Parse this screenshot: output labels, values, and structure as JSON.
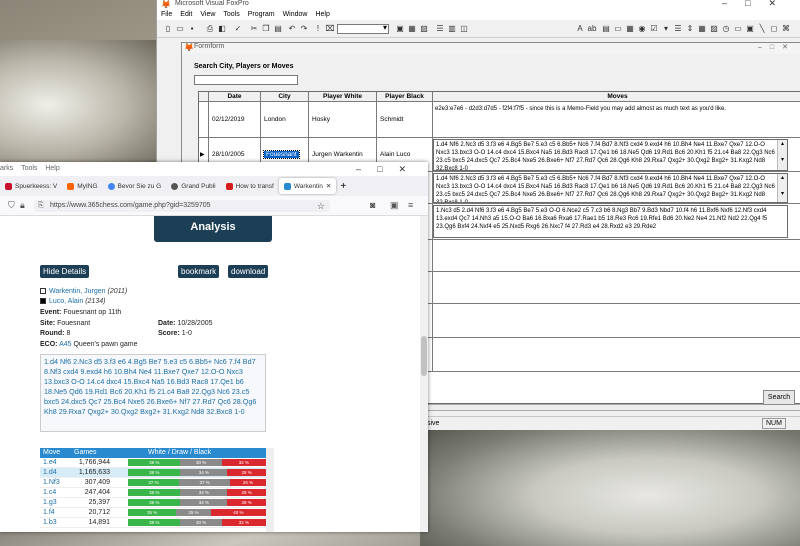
{
  "vfp": {
    "title": "Microsoft Visual FoxPro",
    "menu": [
      "File",
      "Edit",
      "View",
      "Tools",
      "Program",
      "Window",
      "Help"
    ],
    "form_title": "Formform",
    "search_label": "Search City, Players or Moves",
    "search_value": "",
    "columns": [
      "Date",
      "City",
      "Player White",
      "Player Black",
      "Moves"
    ],
    "rows": [
      {
        "date": "02/12/2019",
        "city": "London",
        "white": "Hosky",
        "black": "Schmidt",
        "moves": "e2e3:e7e6 - d2d3:d7d5 - f2f4:f7f5 - since this is a Memo-Field you may add almost as much text as you'd like."
      },
      {
        "date": "28/10/2005",
        "city": "Fouesnant",
        "white": "Jurgen Warkentin",
        "black": "Alain Luco",
        "moves": "1.d4 Nf6 2.Nc3 d5 3.f3 e6 4.Bg5 Be7 5.e3 c5 6.Bb5+ Nc6 7.f4 Bd7 8.Nf3 cxd4 9.exd4 h6 10.Bh4 Ne4 11.Bxe7 Qxe7 12.O-O Nxc3 13.bxc3 O-O 14.c4 dxc4 15.Bxc4 Na5 16.Bd3 Rac8 17.Qe1 b6 18.Ne5 Qd6 19.Rd1 Bc6 20.Kh1 f5 21.c4 Ba8 22.Qg3 Nc6 23.c5 bxc5 24.dxc5 Qc7 25.Bc4 Nxe5 26.Bxe6+ Nf7 27.Rd7 Qc6 28.Qg6 Kh8 29.Rxa7 Qxg2+ 30.Qxg2 Bxg2+ 31.Kxg2 Nd8 32.Bxc8 1-0"
      },
      {
        "date": "",
        "city": "",
        "white": "",
        "black": "",
        "moves": "1.d4 Nf6 2.Nc3 d5 3.f3 e6 4.Bg5 Be7 5.e3 c5 6.Bb5+ Nc6 7.f4 Bd7 8.Nf3 cxd4 9.exd4 h6 10.Bh4 Ne4 11.Bxe7 Qxe7 12.O-O Nxc3 13.bxc3 O-O 14.c4 dxc4 15.Bxc4 Na5 16.Bd3 Rac8 17.Qe1 b6 18.Ne5 Qd6 19.Rd1 Bc6 20.Kh1 f5 21.c4 Ba8 22.Qg3 Nc6 23.c5 bxc5 24.dxc5 Qc7 25.Bc4 Nxe5 26.Bxe6+ Nf7 27.Rd7 Qc6 28.Qg6 Kh8 29.Rxa7 Qxg2+ 30.Qxg2 Bxg2+ 31.Kxg2 Nd8 32.Bxc8 1-0"
      },
      {
        "date": "",
        "city": "",
        "white": "",
        "black": "",
        "moves": "1.Nc3 d5 2.d4 Nf6 3.f3 e6 4.Bg5 Be7 5.e3 O-O 6.Nce2 c5 7.c3 b6 8.Ng3 Bb7 9.Bd3 Nbd7 10.f4 h6 11.Bxf6 Nxf6 12.Nf3 cxd4 13.exd4 Qc7 14.Nh3 a5 15.O-O Ba6 16.Bxa6 Rxa6 17.Rae1 b5 18.Re3 Rc6 19.Rfe1 Bd6 20.Ne2 Ne4 21.Nf2 Nd2 22.Qg4 f5 23.Qg6 Bxf4 24.Nxf4 e5 25.Nxd5 Rxg6 26.Nxc7 f4 27.Rd3 e4 28.Rxd2 e3 29.Rde2"
      }
    ],
    "search_btn": "Search",
    "status_text": "sive",
    "status_num": "NUM"
  },
  "ff": {
    "menu": [
      "arks",
      "Tools",
      "Help"
    ],
    "tabs": [
      "Spuerkeess: V",
      "MyING",
      "Bevor Sie zu G",
      "Grand Publi",
      "How to transf",
      "Warkentin"
    ],
    "url": "https://www.365chess.com/game.php?gid=3259705",
    "analysis": "Analysis",
    "hide": "Hide Details",
    "bookmark": "bookmark",
    "download": "download",
    "white_name": "Warkentin, Jurgen",
    "white_elo": "(2011)",
    "black_name": "Luco, Alain",
    "black_elo": "(2134)",
    "event_label": "Event:",
    "event": "Fouesnant op 11th",
    "site_label": "Site:",
    "site": "Fouesnant",
    "date_label": "Date:",
    "date": "10/28/2005",
    "round_label": "Round:",
    "round": "8",
    "score_label": "Score:",
    "score": "1-0",
    "eco_label": "ECO:",
    "eco": "A45",
    "eco_name": "Queen's pawn game",
    "moves_text": "1.d4 Nf6 2.Nc3 d5 3.f3 e6 4.Bg5 Be7 5.e3 c5 6.Bb5+ Nc6 7.f4 Bd7 8.Nf3 cxd4 9.exd4 h6 10.Bh4 Ne4 11.Bxe7 Qxe7 12.O-O Nxc3 13.bxc3 O-O 14.c4 dxc4 15.Bxc4 Na5 16.Bd3 Rac8 17.Qe1 b6 18.Ne5 Qd6 19.Rd1 Bc6 20.Kh1 f5 21.c4 Ba8 22.Qg3 Nc6 23.c5 bxc5 24.dxc5 Qc7 25.Bc4 Nxe5 26.Bxe6+ Nf7 27.Rd7 Qc6 28.Qg6 Kh8 29.Rxa7 Qxg2+ 30.Qxg2 Bxg2+ 31.Kxg2 Nd8 32.Bxc8 1-0",
    "explorer_headers": [
      "Move",
      "Games",
      "White / Draw / Black"
    ],
    "explorer": [
      {
        "move": "1.e4",
        "games": "1,766,944",
        "w": "38 %",
        "d": "30 %",
        "b": "32 %"
      },
      {
        "move": "1.d4",
        "games": "1,165,633",
        "w": "38 %",
        "d": "34 %",
        "b": "28 %"
      },
      {
        "move": "1.Nf3",
        "games": "307,409",
        "w": "37 %",
        "d": "37 %",
        "b": "26 %"
      },
      {
        "move": "1.c4",
        "games": "247,404",
        "w": "38 %",
        "d": "34 %",
        "b": "28 %"
      },
      {
        "move": "1.g3",
        "games": "25,397",
        "w": "38 %",
        "d": "34 %",
        "b": "28 %"
      },
      {
        "move": "1.f4",
        "games": "20,712",
        "w": "35 %",
        "d": "25 %",
        "b": "40 %"
      },
      {
        "move": "1.b3",
        "games": "14,891",
        "w": "38 %",
        "d": "30 %",
        "b": "32 %"
      }
    ]
  }
}
